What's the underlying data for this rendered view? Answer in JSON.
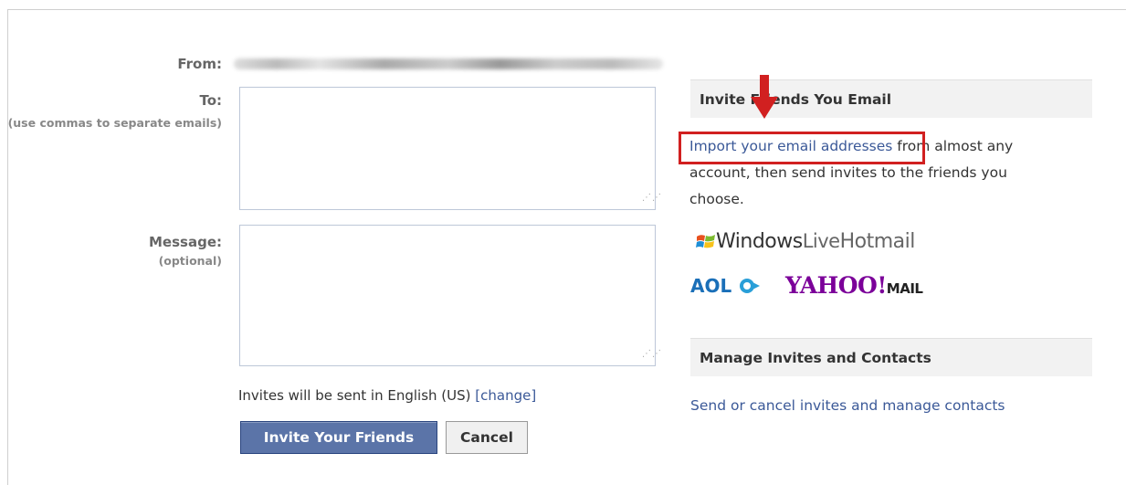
{
  "form": {
    "from_label": "From:",
    "to_label": "To:",
    "to_hint": "(use commas to separate emails)",
    "message_label": "Message:",
    "message_hint": "(optional)",
    "to_value": "",
    "message_value": "",
    "language_note": "Invites will be sent in English (US)",
    "change_link": "[change]",
    "invite_button": "Invite Your Friends",
    "cancel_button": "Cancel"
  },
  "sidebar": {
    "invite_heading": "Invite Friends You Email",
    "import_link": "Import your email addresses",
    "import_text": " from almost any account, then send invites to the friends you choose.",
    "providers": {
      "hotmail_win": "Windows",
      "hotmail_live": "Live",
      "hotmail_name": "Hotmail",
      "aol": "AOL",
      "yahoo": "YAHOO!",
      "yahoo_mail": "MAIL"
    },
    "manage_heading": "Manage Invites and Contacts",
    "manage_link": "Send or cancel invites and manage contacts"
  },
  "colors": {
    "link": "#3b5998",
    "primary_button": "#5b74a8",
    "highlight": "#d12020"
  }
}
